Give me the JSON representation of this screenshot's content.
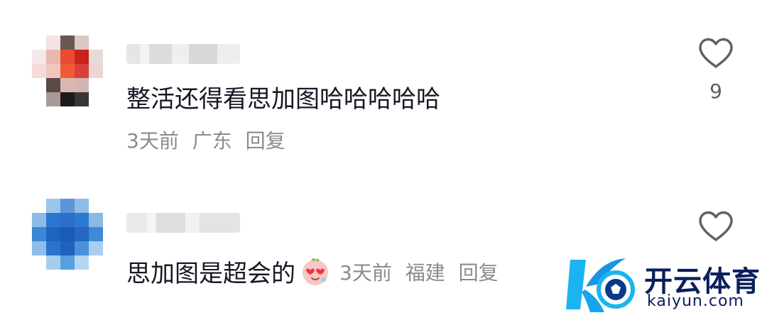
{
  "comments": [
    {
      "text": "整活还得看思加图哈哈哈哈哈",
      "time": "3天前",
      "location": "广东",
      "reply_label": "回复",
      "likes": "9",
      "avatar_icon": "pixelated-avatar-icon",
      "username_redacted": true
    },
    {
      "text": "思加图是超会的",
      "emoji_icon": "heart-eyes-emoji-icon",
      "time": "3天前",
      "location": "福建",
      "reply_label": "回复",
      "avatar_icon": "pixelated-avatar-icon",
      "username_redacted": true
    }
  ],
  "watermark": {
    "name": "开云体育",
    "url": "kaiyun.com",
    "logo_icon": "k-soccer-logo-icon"
  },
  "colors": {
    "text": "#161823",
    "meta": "#8a8b91",
    "like_icon": "#5f6066",
    "brand": "#0a1f5c",
    "brand_accent": "#1bb4f0"
  }
}
